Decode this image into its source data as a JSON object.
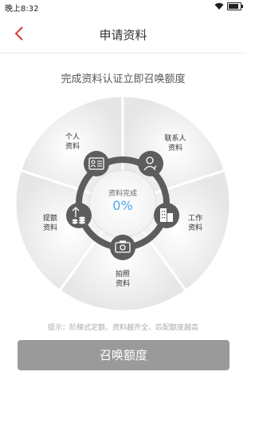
{
  "status_bar": {
    "time": "晚上8:32"
  },
  "nav": {
    "title": "申请资料"
  },
  "subtitle": "完成资料认证立即召唤额度",
  "wheel": {
    "center_title": "资料完成",
    "center_percent": "0%",
    "segments": [
      {
        "key": "personal",
        "line1": "个人",
        "line2": "资料",
        "icon": "id-card-icon"
      },
      {
        "key": "contacts",
        "line1": "联系人",
        "line2": "资料",
        "icon": "contact-person-icon"
      },
      {
        "key": "work",
        "line1": "工作",
        "line2": "资料",
        "icon": "building-icon"
      },
      {
        "key": "photo",
        "line1": "拍照",
        "line2": "资料",
        "icon": "camera-icon"
      },
      {
        "key": "raise",
        "line1": "提额",
        "line2": "资料",
        "icon": "coins-up-icon"
      }
    ]
  },
  "tip": "提示：阶梯式定额、资料越齐全、匹配额度越高",
  "main_button": {
    "label": "召唤额度"
  }
}
